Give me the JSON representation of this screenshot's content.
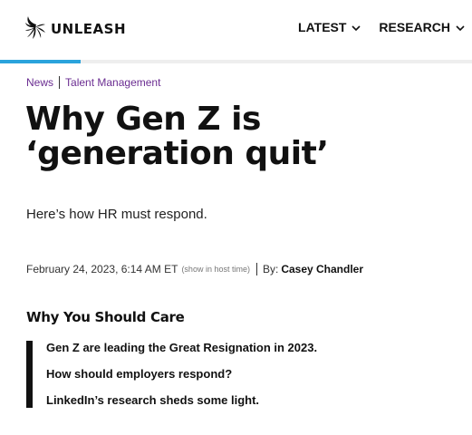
{
  "brand": {
    "name": "UNLEASH",
    "icon": "unleash-swirl-logo"
  },
  "nav": {
    "items": [
      {
        "label": "LATEST",
        "icon": "chevron-down-icon"
      },
      {
        "label": "RESEARCH",
        "icon": "chevron-down-icon"
      }
    ]
  },
  "reading_progress": 0.17,
  "colors": {
    "accent": "#2aa3dc",
    "breadcrumb": "#6a2c91",
    "text": "#111111"
  },
  "breadcrumb": [
    "News",
    "Talent Management"
  ],
  "article": {
    "title": "Why Gen Z is ‘generation quit’",
    "subtitle": "Here’s how HR must respond.",
    "date": "February 24, 2023, 6:14 AM ET",
    "host_time_link": "(show in host time)",
    "by_prefix": "By:",
    "author": "Casey Chandler"
  },
  "why_care": {
    "heading": "Why You Should Care",
    "items": [
      "Gen Z are leading the Great Resignation in 2023.",
      "How should employers respond?",
      "LinkedIn’s research sheds some light."
    ]
  }
}
